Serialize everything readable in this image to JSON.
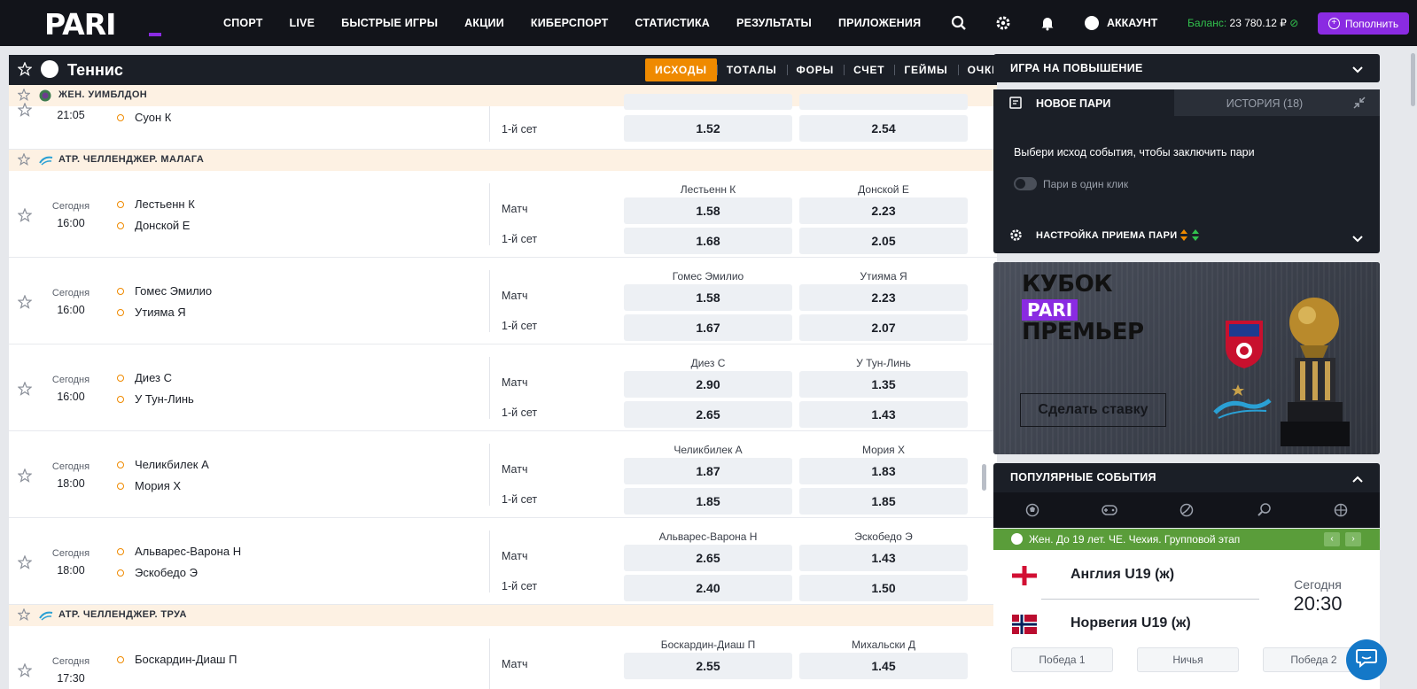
{
  "header": {
    "logo_text": "PARI",
    "nav": [
      "СПОРТ",
      "LIVE",
      "БЫСТРЫЕ ИГРЫ",
      "АКЦИИ",
      "КИБЕРСПОРТ",
      "СТАТИСТИКА",
      "РЕЗУЛЬТАТЫ",
      "ПРИЛОЖЕНИЯ"
    ],
    "account_label": "АККАУНТ",
    "balance_label": "Баланс:",
    "balance_value": "23 780.12 ₽",
    "topup_label": "Пополнить"
  },
  "sport": {
    "title": "Теннис",
    "tabs": [
      "ИСХОДЫ",
      "ТОТАЛЫ",
      "ФОРЫ",
      "СЧЕТ",
      "ГЕЙМЫ",
      "ОЧКИ"
    ],
    "active_tab": "ИСХОДЫ"
  },
  "partial_event": {
    "league": "ЖЕН. УИМБЛДОН",
    "time": "21:05",
    "team": "Суон К",
    "market": "1-й сет",
    "odds": [
      "1.52",
      "2.54"
    ]
  },
  "leagues": [
    {
      "name": "АТР. ЧЕЛЛЕНДЖЕР. МАЛАГА",
      "events": [
        {
          "date": "Сегодня",
          "time": "16:00",
          "team1": "Лестьенн К",
          "team2": "Донской Е",
          "p1": "Лестьенн К",
          "p2": "Донской Е",
          "m1": "Матч",
          "m2": "1-й сет",
          "odds": [
            [
              "1.58",
              "2.23"
            ],
            [
              "1.68",
              "2.05"
            ]
          ]
        },
        {
          "date": "Сегодня",
          "time": "16:00",
          "team1": "Гомес Эмилио",
          "team2": "Утияма Я",
          "p1": "Гомес Эмилио",
          "p2": "Утияма Я",
          "m1": "Матч",
          "m2": "1-й сет",
          "odds": [
            [
              "1.58",
              "2.23"
            ],
            [
              "1.67",
              "2.07"
            ]
          ]
        },
        {
          "date": "Сегодня",
          "time": "16:00",
          "team1": "Диез С",
          "team2": "У Тун-Линь",
          "p1": "Диез С",
          "p2": "У Тун-Линь",
          "m1": "Матч",
          "m2": "1-й сет",
          "odds": [
            [
              "2.90",
              "1.35"
            ],
            [
              "2.65",
              "1.43"
            ]
          ]
        },
        {
          "date": "Сегодня",
          "time": "18:00",
          "team1": "Челикбилек А",
          "team2": "Мория Х",
          "p1": "Челикбилек А",
          "p2": "Мория Х",
          "m1": "Матч",
          "m2": "1-й сет",
          "odds": [
            [
              "1.87",
              "1.83"
            ],
            [
              "1.85",
              "1.85"
            ]
          ]
        },
        {
          "date": "Сегодня",
          "time": "18:00",
          "team1": "Альварес-Варона Н",
          "team2": "Эскобедо Э",
          "p1": "Альварес-Варона Н",
          "p2": "Эскобедо Э",
          "m1": "Матч",
          "m2": "1-й сет",
          "odds": [
            [
              "2.65",
              "1.43"
            ],
            [
              "2.40",
              "1.50"
            ]
          ]
        }
      ]
    },
    {
      "name": "АТР. ЧЕЛЛЕНДЖЕР. ТРУА",
      "events": [
        {
          "date": "Сегодня",
          "time": "17:30",
          "team1": "Боскардин-Диаш П",
          "team2": "",
          "p1": "Боскардин-Диаш П",
          "p2": "Михальски Д",
          "m1": "Матч",
          "m2": "",
          "odds": [
            [
              "2.55",
              "1.45"
            ]
          ]
        }
      ]
    }
  ],
  "right": {
    "raise_title": "ИГРА НА ПОВЫШЕНИЕ",
    "slip_tab_new": "НОВОЕ ПАРИ",
    "slip_tab_history": "ИСТОРИЯ (18)",
    "slip_message": "Выбери исход события, чтобы заключить пари",
    "one_click_label": "Пари в один клик",
    "settings_label": "НАСТРОЙКА ПРИЕМА ПАРИ",
    "banner": {
      "line1": "КУБОК",
      "line2": "PARI",
      "line3": "ПРЕМЬЕР",
      "button": "Сделать ставку"
    },
    "popular_title": "ПОПУЛЯРНЫЕ СОБЫТИЯ",
    "popular_league": "Жен. До 19 лет. ЧЕ. Чехия. Групповой этап",
    "match": {
      "team1": "Англия U19 (ж)",
      "team2": "Норвегия U19 (ж)",
      "date": "Сегодня",
      "time": "20:30",
      "outcomes": [
        "Победа 1",
        "Ничья",
        "Победа 2"
      ]
    }
  },
  "colors": {
    "accent": "#ef8a00",
    "brand": "#8a2be2",
    "header": "#12141a",
    "league_bg": "#fdf1e3",
    "popular_league_bg": "#5a9d3a"
  }
}
